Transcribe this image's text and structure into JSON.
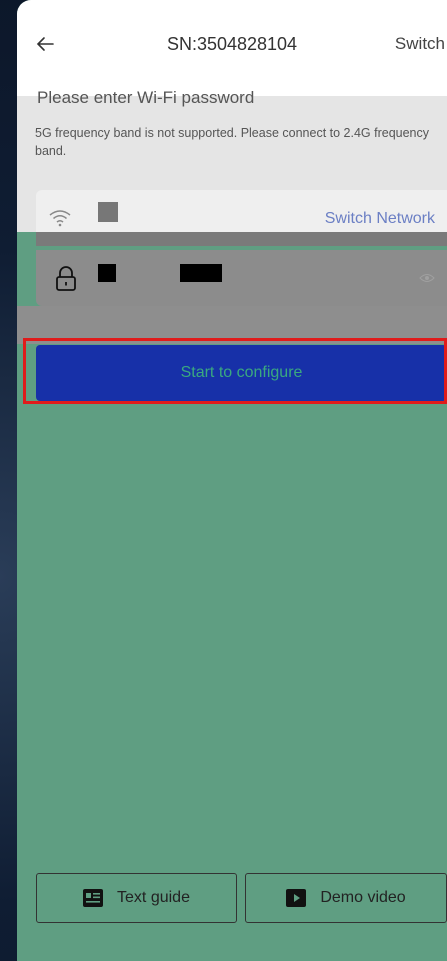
{
  "header": {
    "back_label": "←",
    "title": "SN:3504828104",
    "switch_label": "Switch"
  },
  "wifi": {
    "prompt": "Please enter Wi-Fi password",
    "notice": "5G frequency band is not supported. Please connect to 2.4G frequency band.",
    "switch_network": "Switch Network"
  },
  "actions": {
    "configure": "Start to configure",
    "text_guide": "Text guide",
    "demo_video": "Demo video"
  },
  "icons": {
    "back": "arrow-left-icon",
    "wifi": "wifi-icon",
    "lock": "lock-icon",
    "eye": "eye-icon",
    "guide": "guide-card-icon",
    "video": "play-icon"
  },
  "colors": {
    "background": "#5f9e82",
    "configure_button": "#1730a8",
    "configure_text": "#3aa880",
    "highlight": "#e01b1b",
    "link": "#6b7fc4"
  }
}
